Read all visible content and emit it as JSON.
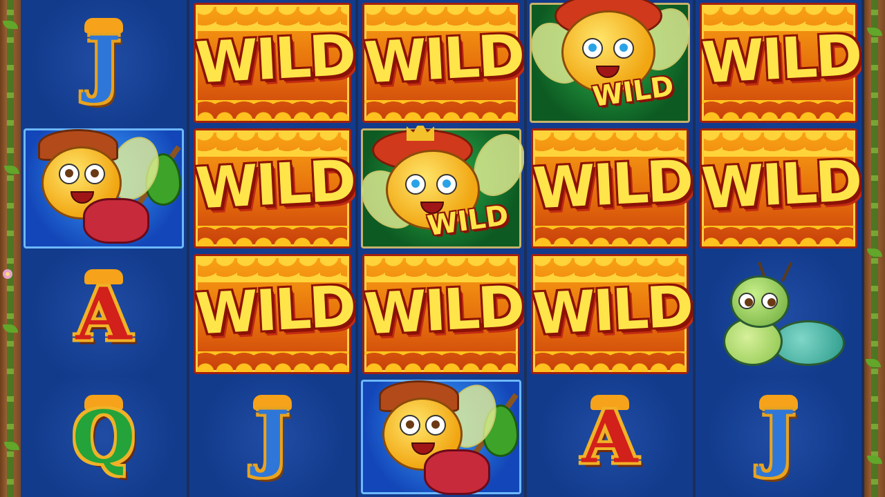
{
  "game": {
    "symbol_labels": {
      "wild": "WILD",
      "j": "J",
      "a": "A",
      "q": "Q"
    },
    "grid": [
      [
        "J",
        "WILD",
        "WILD",
        "WILD",
        "WILD"
      ],
      [
        "bee-worker",
        "WILD",
        "WILD",
        "WILD",
        "WILD"
      ],
      [
        "A",
        "WILD",
        "WILD",
        "WILD",
        "caterpillar"
      ],
      [
        "Q",
        "J",
        "bee-worker",
        "A",
        "J"
      ]
    ],
    "queen_bee_wild_cells": [
      "row0-col3",
      "row1-col2"
    ]
  },
  "colors": {
    "reel_background": "#123b8c",
    "wild_orange": "#e46a0c",
    "wild_text": "#ffe54a",
    "wild_outline": "#8b1206",
    "letter_j": "#2e77d8",
    "letter_a": "#d2201a",
    "letter_q": "#23a33a",
    "gold_trim": "#f0b227",
    "frame_wood": "#a5673a",
    "vine_green": "#62a62a"
  },
  "icons": [
    "worker-bee-icon",
    "queen-bee-icon",
    "caterpillar-icon",
    "honey-drip-icon",
    "leaf-icon",
    "crown-icon"
  ]
}
